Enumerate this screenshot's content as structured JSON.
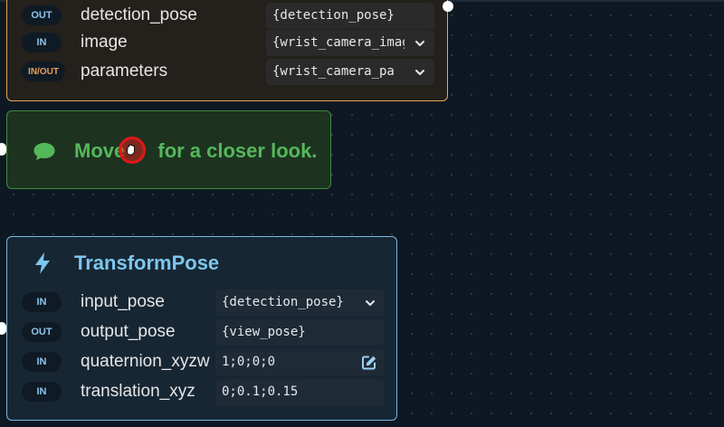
{
  "canvas": {
    "background": "#0d1822"
  },
  "nodes": {
    "orange": {
      "border_color": "#e8a35a",
      "rows": [
        {
          "direction": "OUT",
          "name": "detection_pose",
          "value": "{detection_pose}",
          "control": "none"
        },
        {
          "direction": "IN",
          "name": "image",
          "value": "{wrist_camera_image}",
          "control": "chevron-down-icon"
        },
        {
          "direction": "IN/OUT",
          "name": "parameters",
          "value": "{wrist_camera_pa",
          "control": "chevron-down-icon"
        }
      ]
    },
    "green": {
      "border_color": "#3f8a43",
      "icon": "speech-bubble-icon",
      "text_before": "Move",
      "text_after": " for a closer look."
    },
    "blue": {
      "border_color": "#78b8e0",
      "icon": "lightning-bolt-icon",
      "title": "TransformPose",
      "rows": [
        {
          "direction": "IN",
          "name": "input_pose",
          "value": "{detection_pose}",
          "control": "chevron-down-icon"
        },
        {
          "direction": "OUT",
          "name": "output_pose",
          "value": "{view_pose}",
          "control": "none"
        },
        {
          "direction": "IN",
          "name": "quaternion_xyzw",
          "value": "1;0;0;0",
          "control": "edit-icon"
        },
        {
          "direction": "IN",
          "name": "translation_xyz",
          "value": "0;0.1;0.15",
          "control": "none"
        }
      ]
    }
  },
  "cursor": {
    "icon": "grab-hand-icon",
    "highlight_color": "#e01818"
  }
}
